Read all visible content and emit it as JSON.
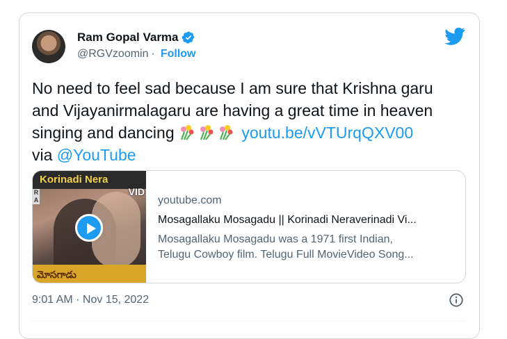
{
  "author": {
    "name": "Ram Gopal Varma",
    "handle": "@RGVzoomin",
    "separator": "·",
    "follow_label": "Follow"
  },
  "tweet": {
    "text_line1": "No need to feel sad because I am sure that Krishna garu",
    "text_line2": "and Vijayanirmalagaru are having a great time in heaven",
    "text_line3_start": "singing and dancing",
    "emoji_name": "bouquet",
    "link": "youtu.be/vVTUrqQXV00",
    "via": "via",
    "mention": "@YouTube"
  },
  "card": {
    "thumbnail_banner": "Korinadi Nera",
    "thumbnail_vid": "VID",
    "thumbnail_tag": "R A",
    "thumbnail_footer": "మోసగాడు",
    "domain": "youtube.com",
    "title": "Mosagallaku Mosagadu || Korinadi Neraverinadi Vi...",
    "desc_line1": "Mosagallaku Mosagadu was a 1971 first Indian,",
    "desc_line2": "Telugu Cowboy film. Telugu Full MovieVideo Song..."
  },
  "meta": {
    "timestamp": "9:01 AM · Nov 15, 2022"
  },
  "colors": {
    "accent": "#1d9bf0",
    "text": "#0f1419",
    "muted": "#536471",
    "border": "#cfd9de"
  },
  "icons": [
    "verified-badge-icon",
    "twitter-bird-icon",
    "bouquet-icon",
    "play-icon",
    "info-icon"
  ]
}
